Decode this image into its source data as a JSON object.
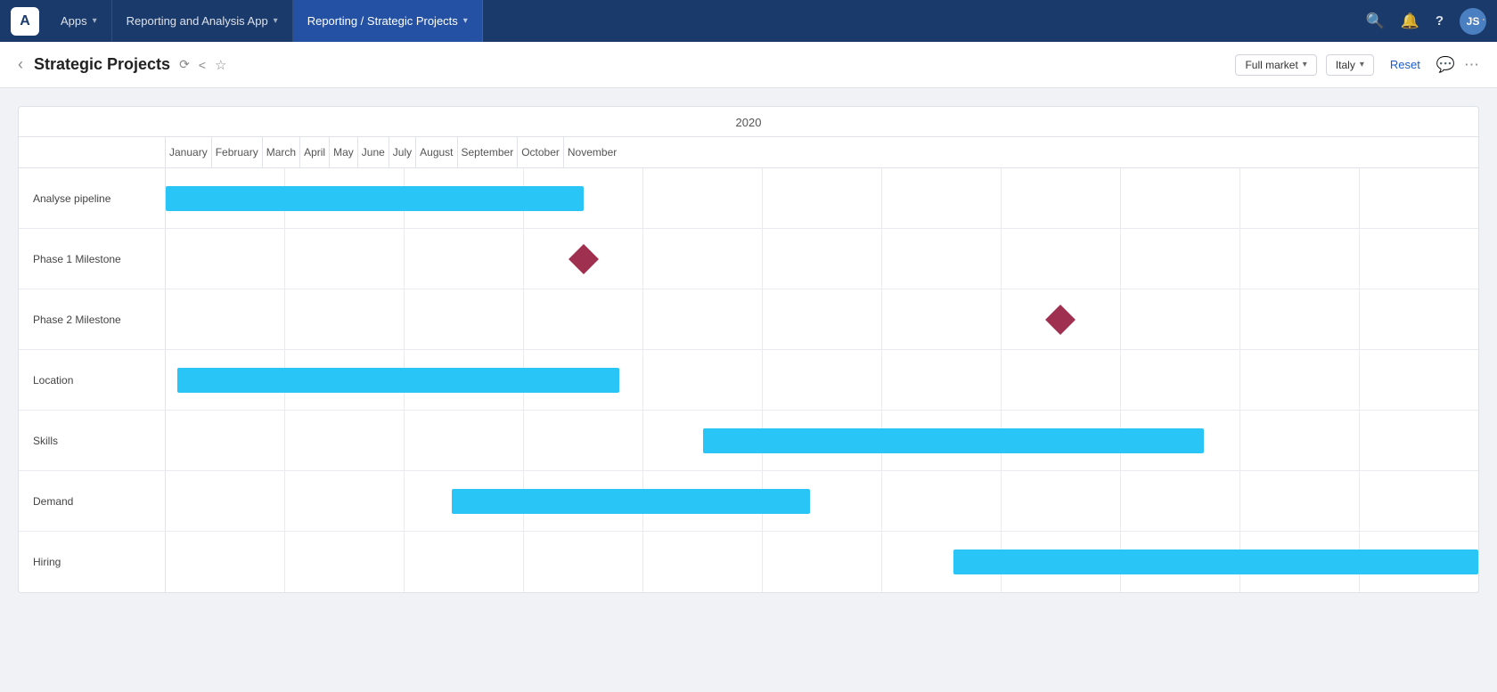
{
  "topbar": {
    "logo": "A",
    "tabs": [
      {
        "id": "apps",
        "label": "Apps",
        "hasChevron": true,
        "active": false
      },
      {
        "id": "reporting-app",
        "label": "Reporting and Analysis App",
        "hasChevron": true,
        "active": false
      },
      {
        "id": "reporting-strategic",
        "label": "Reporting / Strategic Projects",
        "hasChevron": true,
        "active": true
      }
    ],
    "actions": {
      "search": "🔍",
      "bell": "🔔",
      "help": "?",
      "avatar": "JS"
    }
  },
  "subheader": {
    "back_icon": "‹",
    "title": "Strategic Projects",
    "sync_icon": "↻",
    "share_icon": "⊲",
    "star_icon": "☆",
    "filters": {
      "market": "Full market",
      "country": "Italy"
    },
    "reset_label": "Reset",
    "comment_icon": "💬",
    "more_icon": "⋯"
  },
  "gantt": {
    "year": "2020",
    "months": [
      "January",
      "February",
      "March",
      "April",
      "May",
      "June",
      "July",
      "August",
      "September",
      "October",
      "November"
    ],
    "rows": [
      {
        "id": "analyse-pipeline",
        "label": "Analyse pipeline",
        "type": "bar",
        "startMonth": 0,
        "startOffset": 0.0,
        "endMonth": 3,
        "endOffset": 0.5
      },
      {
        "id": "phase1-milestone",
        "label": "Phase 1 Milestone",
        "type": "diamond",
        "month": 3,
        "offset": 0.5
      },
      {
        "id": "phase2-milestone",
        "label": "Phase 2 Milestone",
        "type": "diamond",
        "month": 7,
        "offset": 0.5
      },
      {
        "id": "location",
        "label": "Location",
        "type": "bar",
        "startMonth": 0,
        "startOffset": 0.1,
        "endMonth": 3,
        "endOffset": 0.8
      },
      {
        "id": "skills",
        "label": "Skills",
        "type": "bar",
        "startMonth": 4,
        "startOffset": 0.6,
        "endMonth": 8,
        "endOffset": 0.7
      },
      {
        "id": "demand",
        "label": "Demand",
        "type": "bar",
        "startMonth": 2,
        "startOffset": 0.4,
        "endMonth": 5,
        "endOffset": 0.3
      },
      {
        "id": "hiring",
        "label": "Hiring",
        "type": "bar",
        "startMonth": 6,
        "startOffset": 0.7,
        "endMonth": 10,
        "endOffset": 1.0
      }
    ]
  },
  "colors": {
    "topbar_bg": "#1a3a6b",
    "topbar_active": "#2451a3",
    "bar_color": "#29c5f6",
    "diamond_color": "#a03050",
    "border_color": "#e0e4ea"
  }
}
